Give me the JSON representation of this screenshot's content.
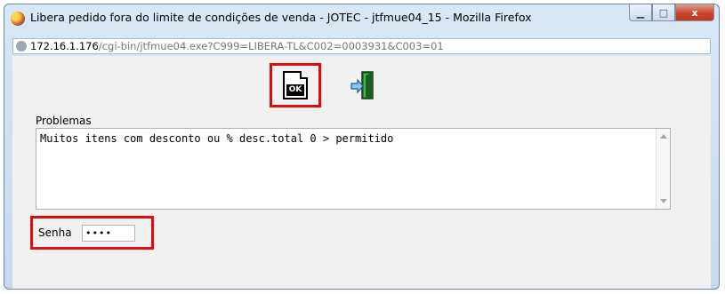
{
  "window": {
    "title": "Libera pedido fora do limite de condições de venda - JOTEC - jtfmue04_15 - Mozilla Firefox",
    "buttons": {
      "minimize": "▁",
      "maximize": "□",
      "close": "x"
    }
  },
  "urlbar": {
    "host": "172.16.1.176",
    "path": "/cgi-bin/jtfmue04.exe?C999=LIBERA-TL&C002=0003931&C003=01"
  },
  "toolbar": {
    "ok_label": "OK",
    "ok_icon": "ok-document-icon",
    "exit_icon": "exit-door-icon"
  },
  "problems": {
    "label": "Problemas",
    "text": "Muitos itens com desconto ou % desc.total 0 > permitido"
  },
  "senha": {
    "label": "Senha",
    "value": "••••"
  },
  "colors": {
    "highlight": "#e20b0b",
    "titlebar": "#d9e7f5",
    "content_bg": "#f1f1f1"
  }
}
